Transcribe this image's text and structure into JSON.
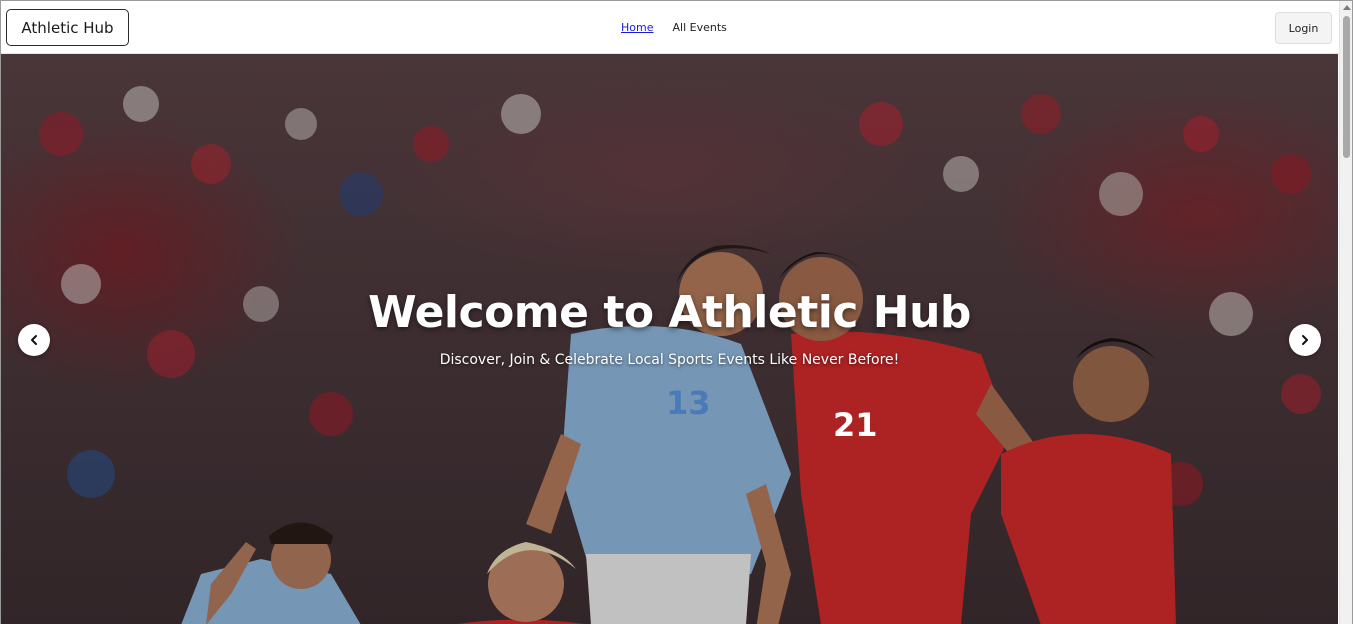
{
  "navbar": {
    "brand": "Athletic Hub",
    "links": [
      {
        "label": "Home",
        "active": true
      },
      {
        "label": "All Events",
        "active": false
      }
    ],
    "login_label": "Login"
  },
  "hero": {
    "title": "Welcome to Athletic Hub",
    "subtitle": "Discover, Join & Celebrate Local Sports Events Like Never Before!",
    "prev_icon": "chevron-left-icon",
    "next_icon": "chevron-right-icon"
  },
  "players": [
    {
      "number": "13",
      "kit_color": "#8fb8dc"
    },
    {
      "number": "21",
      "kit_color": "#d42a2a"
    }
  ],
  "colors": {
    "link_active": "#1a1ae0",
    "kit_blue": "#8fb8dc",
    "kit_red": "#d42a2a"
  }
}
